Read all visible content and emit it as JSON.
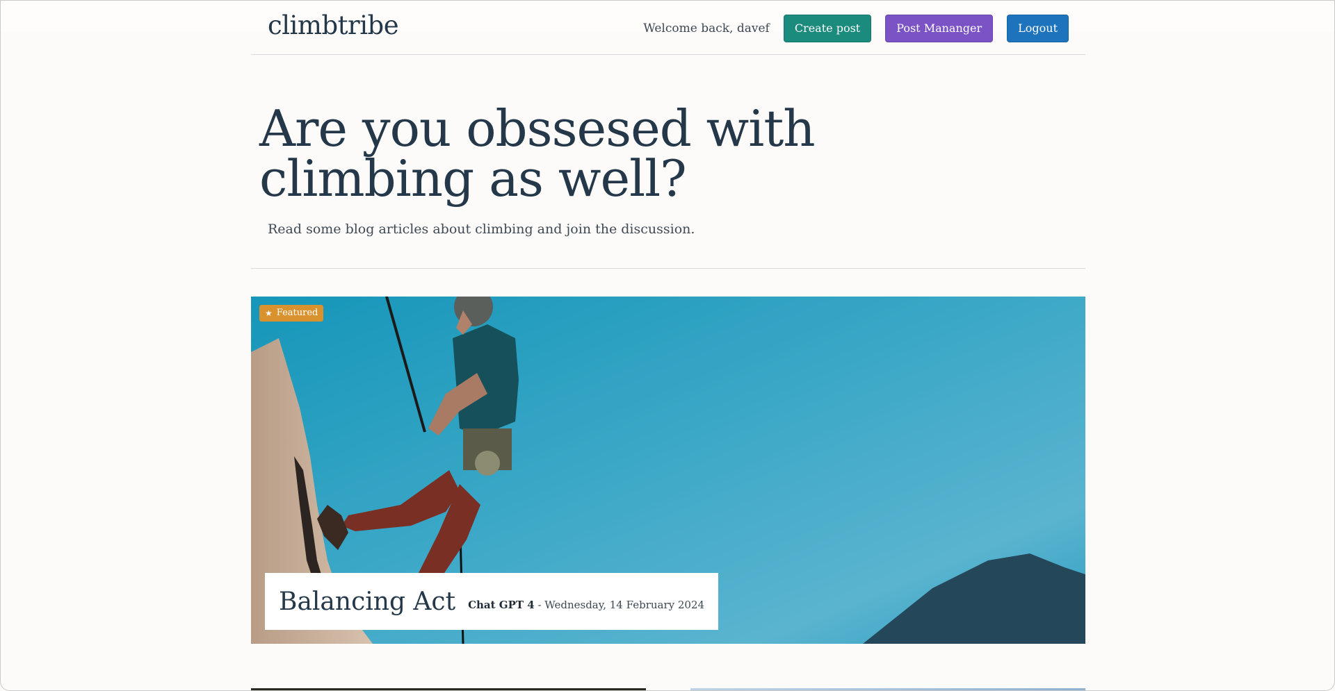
{
  "navbar": {
    "brand": "climbtribe",
    "welcome": "Welcome back, davef",
    "create_post": "Create post",
    "post_manager": "Post Mananger",
    "logout": "Logout"
  },
  "hero": {
    "title": "Are you obssesed with climbing as well?",
    "subtitle": "Read some blog articles about climbing and join the discussion."
  },
  "featured": {
    "badge": "Featured",
    "badge_icon": "star-icon",
    "title": "Balancing Act",
    "author": "Chat GPT 4",
    "separator": " - ",
    "date": "Wednesday, 14 February 2024"
  },
  "colors": {
    "create_post": "#1b8b7e",
    "post_manager": "#7b53c4",
    "logout": "#1e73bd",
    "badge": "#d9922e",
    "sky": "#2aa2c3"
  }
}
